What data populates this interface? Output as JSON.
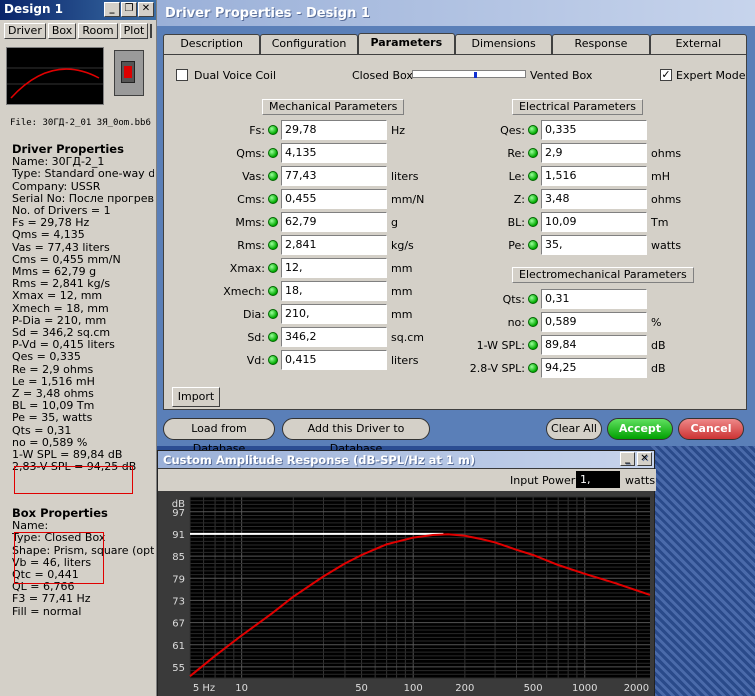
{
  "colors": {
    "accent": "#00c000",
    "cancel": "#d04040",
    "curve": "#e00000",
    "grid": "#4a4a4a"
  },
  "left_window": {
    "title": "Design 1",
    "tabs": [
      "Driver",
      "Box",
      "Room",
      "Plot"
    ],
    "file": "File: 30ГД-2_01 3Я_0om.bb6",
    "driver_header": "Driver Properties",
    "driver_lines": [
      "Name: 30ГД-2_1",
      "Type: Standard one-way driver",
      "Company: USSR",
      "Serial No: После прогрева",
      "No. of Drivers = 1",
      "Fs = 29,78 Hz",
      "Qms = 4,135",
      "Vas = 77,43 liters",
      "Cms = 0,455 mm/N",
      "Mms = 62,79 g",
      "Rms = 2,841 kg/s",
      "Xmax = 12, mm",
      "Xmech = 18, mm",
      "P-Dia = 210, mm",
      "Sd = 346,2 sq.cm",
      "P-Vd = 0,415 liters",
      "Qes = 0,335",
      "Re = 2,9 ohms",
      "Le = 1,516 mH",
      "Z = 3,48 ohms",
      "BL = 10,09 Tm",
      "Pe = 35, watts",
      "Qts = 0,31",
      "no = 0,589 %",
      "1-W SPL = 89,84 dB",
      "2,83-V SPL = 94,25 dB"
    ],
    "box_header": "Box Properties",
    "box_lines": [
      "Name:",
      "Type: Closed Box",
      "Shape: Prism, square (optimum)",
      "Vb = 46, liters",
      "Qtc = 0,441",
      "QL = 6,766",
      "F3 = 77,41 Hz",
      "Fill = normal"
    ]
  },
  "dialog": {
    "title": "Driver Properties - Design 1",
    "tabs": [
      "Description",
      "Configuration",
      "Parameters",
      "Dimensions",
      "Response",
      "External"
    ],
    "active_tab": "Parameters",
    "dual_voice_coil": "Dual Voice Coil",
    "closed_box": "Closed Box",
    "vented_box": "Vented Box",
    "expert_mode": "Expert Mode",
    "mech_header": "Mechanical Parameters",
    "elec_header": "Electrical Parameters",
    "em_header": "Electromechanical Parameters",
    "mech_params": [
      {
        "label": "Fs:",
        "value": "29,78",
        "unit": "Hz"
      },
      {
        "label": "Qms:",
        "value": "4,135",
        "unit": ""
      },
      {
        "label": "Vas:",
        "value": "77,43",
        "unit": "liters"
      },
      {
        "label": "Cms:",
        "value": "0,455",
        "unit": "mm/N"
      },
      {
        "label": "Mms:",
        "value": "62,79",
        "unit": "g"
      },
      {
        "label": "Rms:",
        "value": "2,841",
        "unit": "kg/s"
      },
      {
        "label": "Xmax:",
        "value": "12,",
        "unit": "mm"
      },
      {
        "label": "Xmech:",
        "value": "18,",
        "unit": "mm"
      },
      {
        "label": "Dia:",
        "value": "210,",
        "unit": "mm"
      },
      {
        "label": "Sd:",
        "value": "346,2",
        "unit": "sq.cm"
      },
      {
        "label": "Vd:",
        "value": "0,415",
        "unit": "liters"
      }
    ],
    "elec_params": [
      {
        "label": "Qes:",
        "value": "0,335",
        "unit": ""
      },
      {
        "label": "Re:",
        "value": "2,9",
        "unit": "ohms"
      },
      {
        "label": "Le:",
        "value": "1,516",
        "unit": "mH"
      },
      {
        "label": "Z:",
        "value": "3,48",
        "unit": "ohms"
      },
      {
        "label": "BL:",
        "value": "10,09",
        "unit": "Tm"
      },
      {
        "label": "Pe:",
        "value": "35,",
        "unit": "watts"
      }
    ],
    "em_params": [
      {
        "label": "Qts:",
        "value": "0,31",
        "unit": ""
      },
      {
        "label": "no:",
        "value": "0,589",
        "unit": "%"
      },
      {
        "label": "1-W SPL:",
        "value": "89,84",
        "unit": "dB"
      },
      {
        "label": "2.8-V SPL:",
        "value": "94,25",
        "unit": "dB"
      }
    ],
    "import": "Import",
    "load_db": "Load from Database",
    "add_db": "Add this Driver to Database",
    "clear_all": "Clear All",
    "accept": "Accept",
    "cancel": "Cancel"
  },
  "graph": {
    "title": "Custom Amplitude Response (dB-SPL/Hz at 1 m)",
    "input_power_label": "Input Power:",
    "input_power_value": "1,",
    "input_power_unit": "watts"
  },
  "chart_data": {
    "type": "line",
    "ylabel": "dB",
    "x_scale": "log",
    "xlim": [
      5,
      2400
    ],
    "ylim": [
      52,
      101
    ],
    "y_ticks": [
      55,
      61,
      67,
      73,
      79,
      85,
      91,
      97
    ],
    "x_tick_labels": [
      {
        "v": 5,
        "t": "5 Hz"
      },
      {
        "v": 10,
        "t": "10"
      },
      {
        "v": 50,
        "t": "50"
      },
      {
        "v": 100,
        "t": "100"
      },
      {
        "v": 200,
        "t": "200"
      },
      {
        "v": 500,
        "t": "500"
      },
      {
        "v": 1000,
        "t": "1000"
      },
      {
        "v": 2000,
        "t": "2000"
      }
    ],
    "series": [
      {
        "color": "#ffffff",
        "x": [
          5,
          150
        ],
        "y": [
          91,
          91
        ]
      },
      {
        "color": "#e00000",
        "x": [
          5,
          7,
          10,
          15,
          20,
          30,
          40,
          50,
          70,
          100,
          130,
          160,
          200,
          250,
          300,
          400,
          500,
          700,
          1000,
          1500,
          2400
        ],
        "y": [
          52.5,
          58,
          63.5,
          69.5,
          74,
          79.5,
          83,
          85.3,
          88.2,
          90,
          90.7,
          90.9,
          90.5,
          89.6,
          88.7,
          86.7,
          85.3,
          82.6,
          80.2,
          77.7,
          74.5
        ]
      }
    ]
  }
}
